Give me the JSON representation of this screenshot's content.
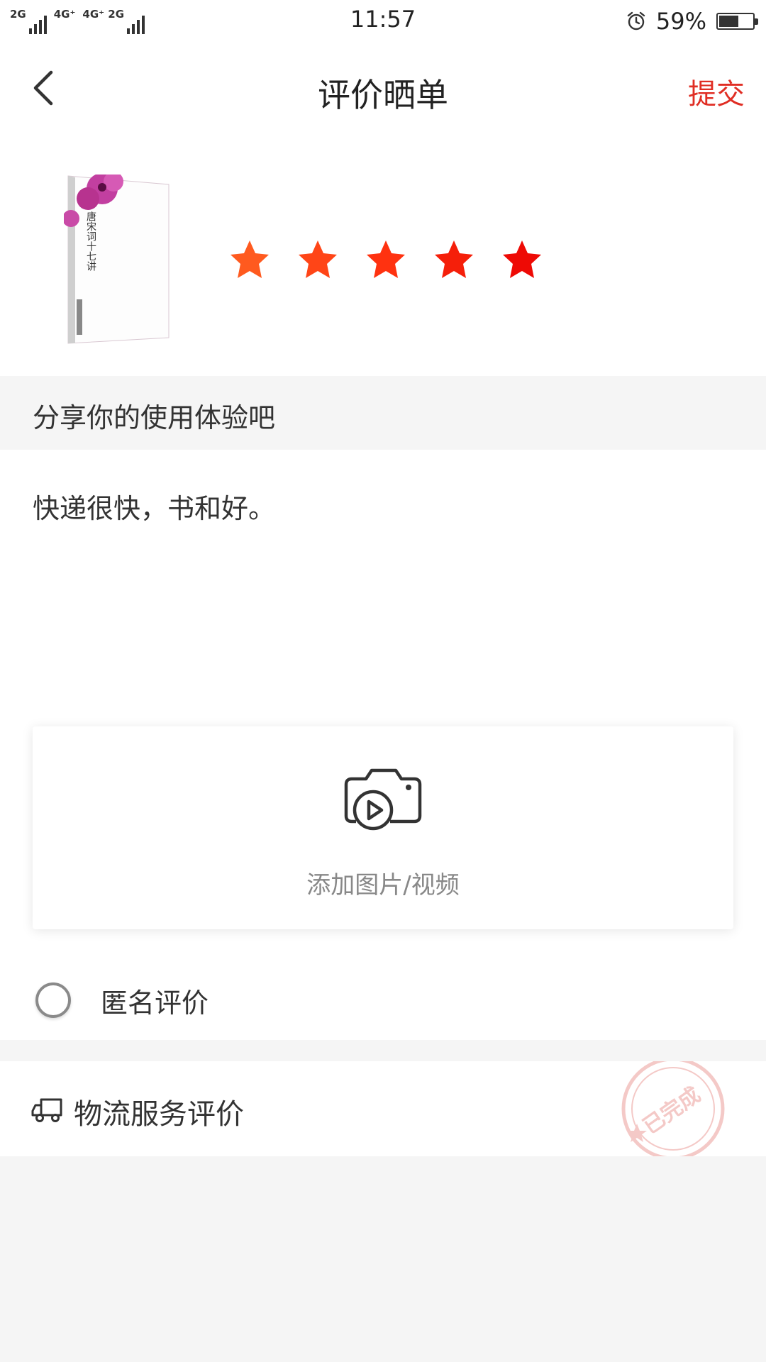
{
  "status_bar": {
    "net1": "2G",
    "net2": "4G⁺",
    "net3": "4G⁺ 2G",
    "time": "11:57",
    "battery_percent_text": "59%",
    "battery_level": 0.59
  },
  "header": {
    "title": "评价晒单",
    "submit_label": "提交"
  },
  "product": {
    "cover_title": "唐宋词十七讲",
    "rating": 5,
    "rating_max": 5,
    "star_colors": [
      "#ff5a1f",
      "#ff4517",
      "#ff3210",
      "#f51f0a",
      "#ee0a05"
    ]
  },
  "review": {
    "prompt": "分享你的使用体验吧",
    "text": "快递很快，书和好。",
    "upload_label": "添加图片/视频",
    "anonymous_label": "匿名评价"
  },
  "logistics": {
    "label": "物流服务评价",
    "stamp_text": "已完成"
  },
  "colors": {
    "accent": "#e02e24",
    "background": "#f5f5f5"
  }
}
